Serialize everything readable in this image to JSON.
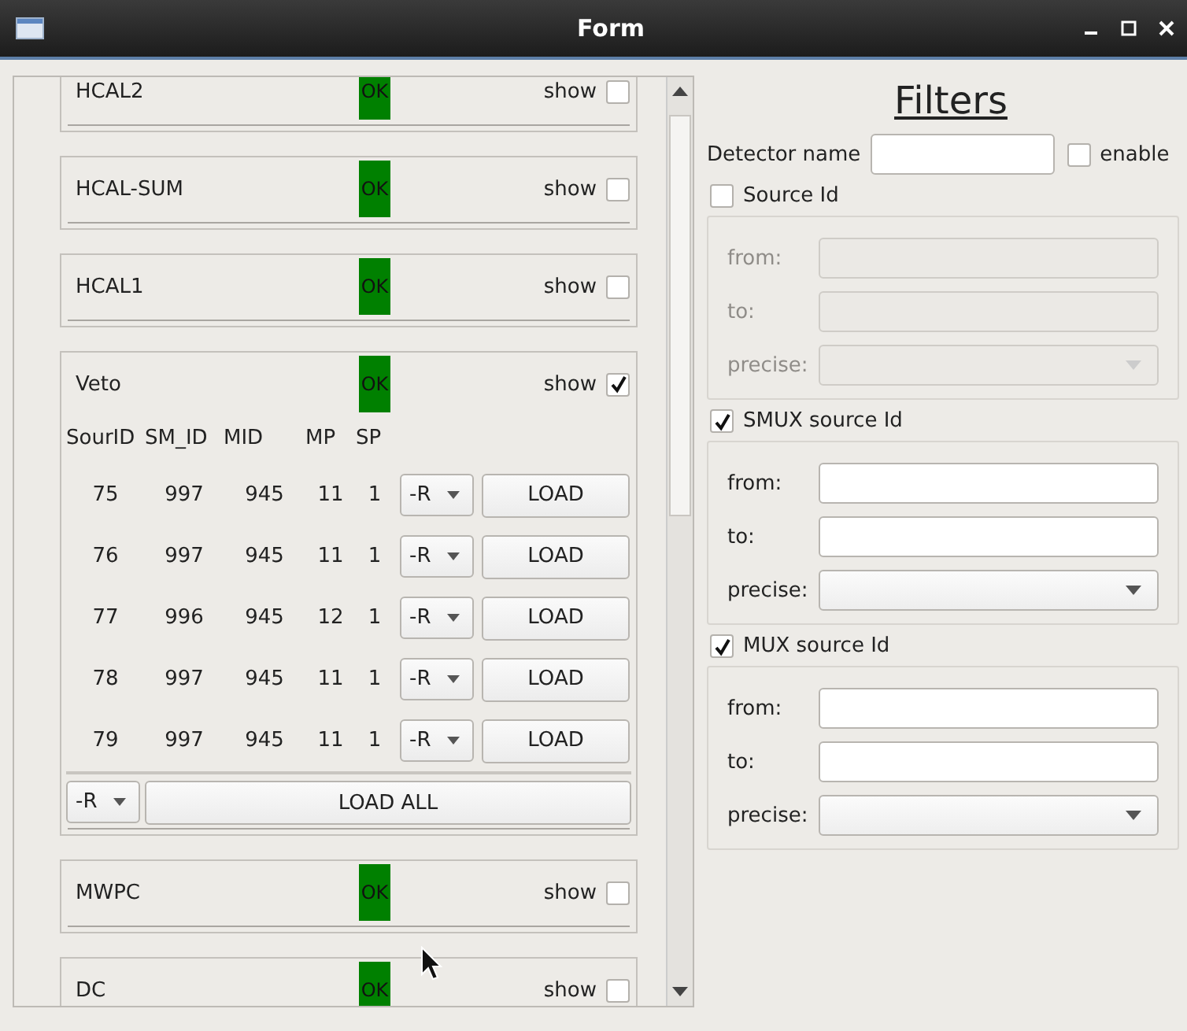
{
  "window": {
    "title": "Form"
  },
  "detectors": [
    {
      "name": "HCAL2",
      "status": "OK",
      "color": "#008000",
      "show_label": "show",
      "show": false
    },
    {
      "name": "HCAL-SUM",
      "status": "OK",
      "color": "#008000",
      "show_label": "show",
      "show": false
    },
    {
      "name": "HCAL1",
      "status": "OK",
      "color": "#008000",
      "show_label": "show",
      "show": false
    },
    {
      "name": "Veto",
      "status": "OK",
      "color": "#008000",
      "show_label": "show",
      "show": true,
      "table": {
        "columns": [
          "SourID",
          "SM_ID",
          "MID",
          "MP",
          "SP"
        ],
        "rows": [
          {
            "cells": [
              "75",
              "997",
              "945",
              "11",
              "1"
            ],
            "mode": "-R",
            "button": "LOAD"
          },
          {
            "cells": [
              "76",
              "997",
              "945",
              "11",
              "1"
            ],
            "mode": "-R",
            "button": "LOAD"
          },
          {
            "cells": [
              "77",
              "996",
              "945",
              "12",
              "1"
            ],
            "mode": "-R",
            "button": "LOAD"
          },
          {
            "cells": [
              "78",
              "997",
              "945",
              "11",
              "1"
            ],
            "mode": "-R",
            "button": "LOAD"
          },
          {
            "cells": [
              "79",
              "997",
              "945",
              "11",
              "1"
            ],
            "mode": "-R",
            "button": "LOAD"
          }
        ],
        "footer": {
          "mode": "-R",
          "button": "LOAD ALL"
        }
      }
    },
    {
      "name": "MWPC",
      "status": "OK",
      "color": "#008000",
      "show_label": "show",
      "show": false
    },
    {
      "name": "DC",
      "status": "OK",
      "color": "#008000",
      "show_label": "show",
      "show": false
    }
  ],
  "filters": {
    "title": "Filters",
    "detector_name": {
      "label": "Detector name",
      "enable_label": "enable",
      "enabled": false
    },
    "groups": [
      {
        "label": "Source Id",
        "checked": false,
        "fields": [
          {
            "label": "from:",
            "kind": "text"
          },
          {
            "label": "to:",
            "kind": "text"
          },
          {
            "label": "precise:",
            "kind": "combo"
          }
        ]
      },
      {
        "label": "SMUX source Id",
        "checked": true,
        "fields": [
          {
            "label": "from:",
            "kind": "text"
          },
          {
            "label": "to:",
            "kind": "text"
          },
          {
            "label": "precise:",
            "kind": "combo"
          }
        ]
      },
      {
        "label": "MUX source Id",
        "checked": true,
        "fields": [
          {
            "label": "from:",
            "kind": "text"
          },
          {
            "label": "to:",
            "kind": "text"
          },
          {
            "label": "precise:",
            "kind": "combo"
          }
        ]
      }
    ]
  }
}
